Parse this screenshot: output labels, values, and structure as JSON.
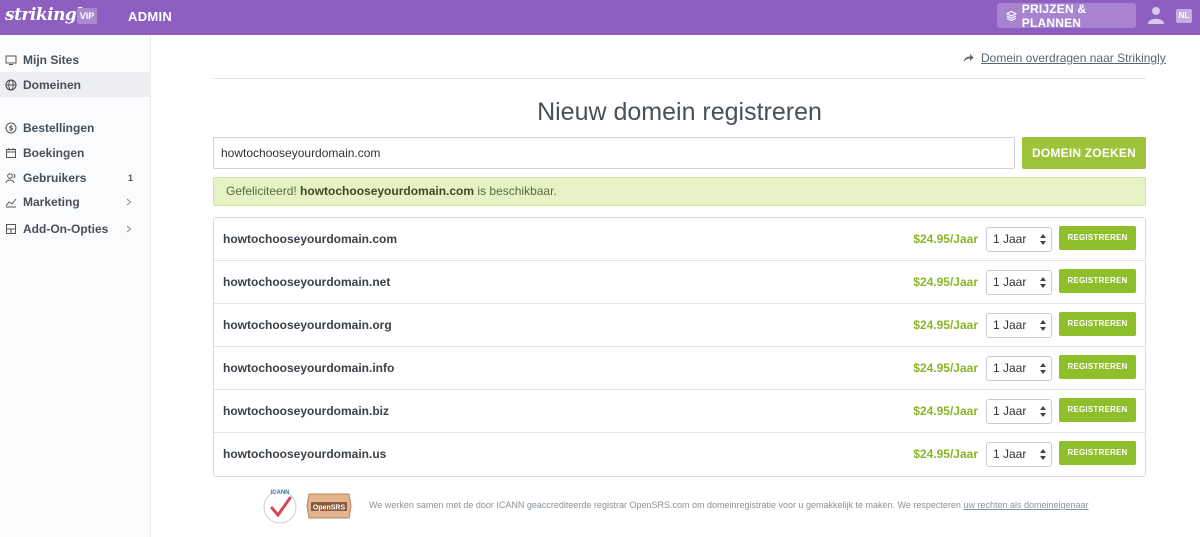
{
  "header": {
    "logo": "strikingly",
    "vip_badge": "VIP",
    "admin_label": "ADMIN",
    "pricing_label": "PRIJZEN & PLANNEN",
    "lang": "NL",
    "brand_color": "#8c5fc0"
  },
  "sidebar": {
    "items": [
      {
        "label": "Mijn Sites",
        "icon": "monitor-icon"
      },
      {
        "label": "Domeinen",
        "icon": "globe-icon",
        "active": true
      },
      {
        "label": "Bestellingen",
        "icon": "dollar-circle-icon"
      },
      {
        "label": "Boekingen",
        "icon": "calendar-icon"
      },
      {
        "label": "Gebruikers",
        "icon": "users-icon",
        "badge": "1"
      },
      {
        "label": "Marketing",
        "icon": "chart-icon"
      },
      {
        "label": "Add-On-Opties",
        "icon": "addon-icon"
      }
    ]
  },
  "main": {
    "transfer_link": "Domein overdragen naar Strikingly",
    "title": "Nieuw domein registreren",
    "search_value": "howtochooseyourdomain.com",
    "search_button": "DOMEIN ZOEKEN",
    "success_prefix": "Gefeliciteerd! ",
    "success_domain": "howtochooseyourdomain.com",
    "success_suffix": " is beschikbaar.",
    "accent_color": "#9cc33a",
    "results": [
      {
        "domain": "howtochooseyourdomain.com",
        "price": "$24.95/Jaar",
        "period": "1 Jaar",
        "button": "REGISTREREN"
      },
      {
        "domain": "howtochooseyourdomain.net",
        "price": "$24.95/Jaar",
        "period": "1 Jaar",
        "button": "REGISTREREN"
      },
      {
        "domain": "howtochooseyourdomain.org",
        "price": "$24.95/Jaar",
        "period": "1 Jaar",
        "button": "REGISTREREN"
      },
      {
        "domain": "howtochooseyourdomain.info",
        "price": "$24.95/Jaar",
        "period": "1 Jaar",
        "button": "REGISTREREN"
      },
      {
        "domain": "howtochooseyourdomain.biz",
        "price": "$24.95/Jaar",
        "period": "1 Jaar",
        "button": "REGISTREREN"
      },
      {
        "domain": "howtochooseyourdomain.us",
        "price": "$24.95/Jaar",
        "period": "1 Jaar",
        "button": "REGISTREREN"
      }
    ],
    "footer_text": "We werken samen met de door ICANN geaccrediteerde registrar OpenSRS.com om domeinregistratie voor u gemakkelijk te maken. We respecteren ",
    "footer_link": "uw rechten als domeineigenaar",
    "icann_logo_text": "ICANN",
    "opensrs_logo_text": "OpenSRS"
  }
}
